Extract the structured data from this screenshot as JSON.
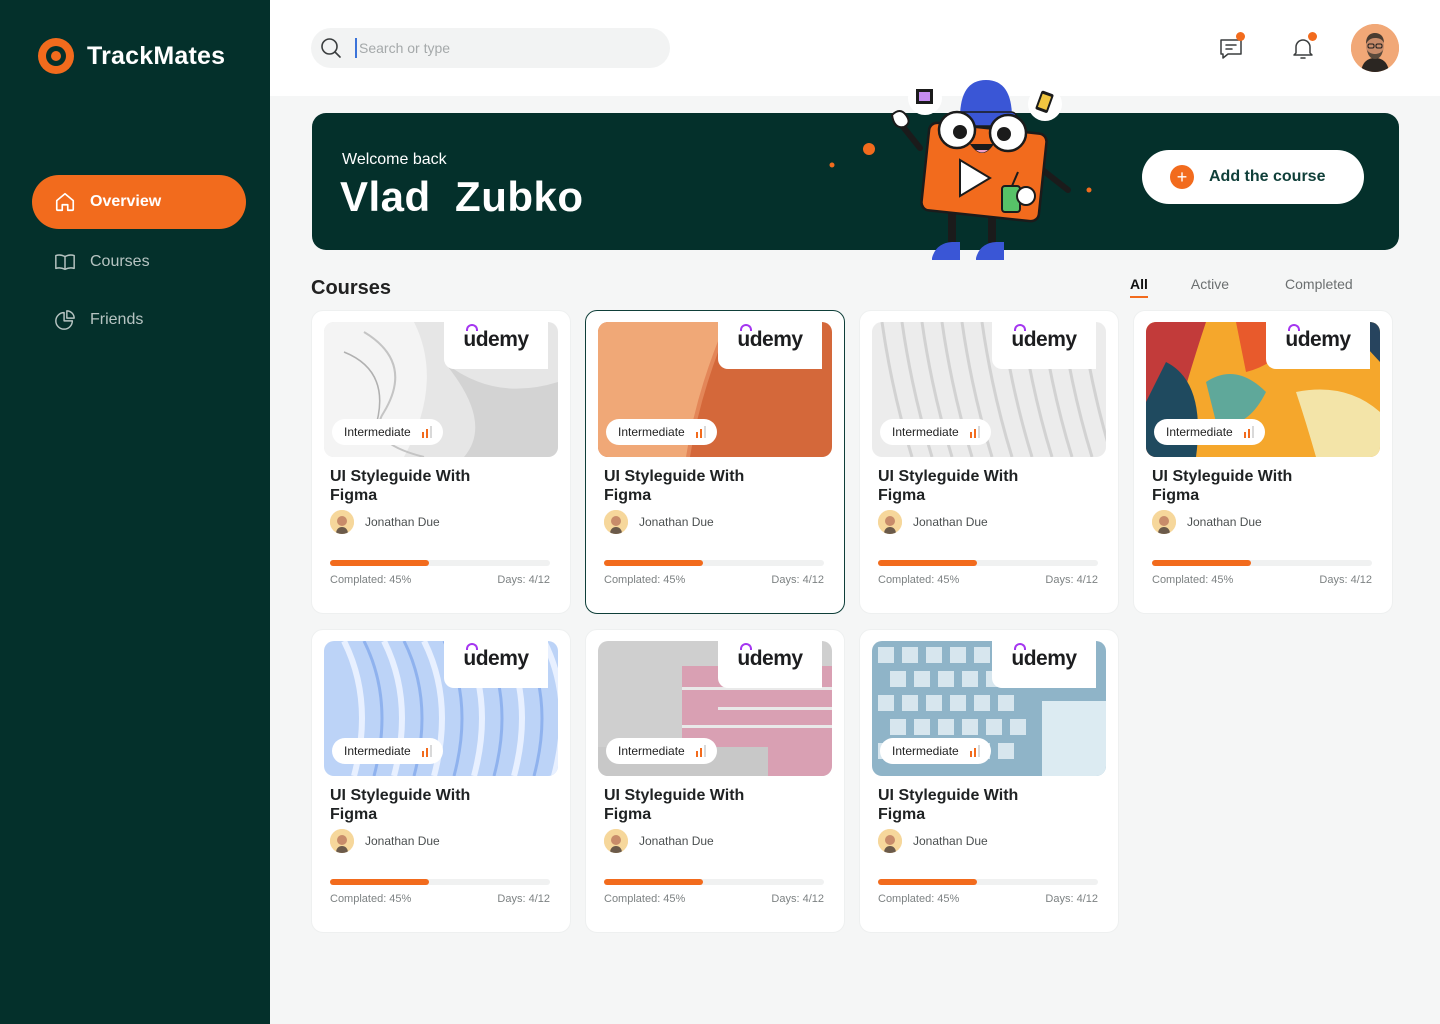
{
  "brand": {
    "name": "TrackMates",
    "accent": "#f26b1d",
    "dark": "#04302b"
  },
  "sidebar": {
    "items": [
      {
        "label": "Overview",
        "icon": "home-icon",
        "active": true
      },
      {
        "label": "Courses",
        "icon": "book-icon",
        "active": false
      },
      {
        "label": "Friends",
        "icon": "pie-chart-icon",
        "active": false
      }
    ]
  },
  "topbar": {
    "search_placeholder": "Search or type",
    "icons": [
      "message-icon",
      "bell-icon"
    ]
  },
  "banner": {
    "welcome": "Welcome back",
    "first_name": "Vlad",
    "last_name": "Zubko",
    "add_label": "Add the course"
  },
  "courses": {
    "title": "Courses",
    "filters": [
      "All",
      "Active",
      "Completed"
    ],
    "selected_filter": "All",
    "items": [
      {
        "provider": "udemy",
        "level": "Intermediate",
        "title": "UI Styleguide With Figma",
        "author": "Jonathan Due",
        "progress": 0.45,
        "completed_label": "Complated: 45%",
        "days_label": "Days: 4/12",
        "selected": false,
        "thumb": "grey-fabric"
      },
      {
        "provider": "udemy",
        "level": "Intermediate",
        "title": "UI Styleguide With Figma",
        "author": "Jonathan Due",
        "progress": 0.45,
        "completed_label": "Complated: 45%",
        "days_label": "Days: 4/12",
        "selected": true,
        "thumb": "orange-wall"
      },
      {
        "provider": "udemy",
        "level": "Intermediate",
        "title": "UI Styleguide With Figma",
        "author": "Jonathan Due",
        "progress": 0.45,
        "completed_label": "Complated: 45%",
        "days_label": "Days: 4/12",
        "selected": false,
        "thumb": "white-waves"
      },
      {
        "provider": "udemy",
        "level": "Intermediate",
        "title": "UI Styleguide With Figma",
        "author": "Jonathan Due",
        "progress": 0.45,
        "completed_label": "Complated: 45%",
        "days_label": "Days: 4/12",
        "selected": false,
        "thumb": "colorful-paint"
      },
      {
        "provider": "udemy",
        "level": "Intermediate",
        "title": "UI Styleguide With Figma",
        "author": "Jonathan Due",
        "progress": 0.45,
        "completed_label": "Complated: 45%",
        "days_label": "Days: 4/12",
        "selected": false,
        "thumb": "blue-waves"
      },
      {
        "provider": "udemy",
        "level": "Intermediate",
        "title": "UI Styleguide With Figma",
        "author": "Jonathan Due",
        "progress": 0.45,
        "completed_label": "Complated: 45%",
        "days_label": "Days: 4/12",
        "selected": false,
        "thumb": "pink-wall"
      },
      {
        "provider": "udemy",
        "level": "Intermediate",
        "title": "UI Styleguide With Figma",
        "author": "Jonathan Due",
        "progress": 0.45,
        "completed_label": "Complated: 45%",
        "days_label": "Days: 4/12",
        "selected": false,
        "thumb": "glass-building"
      }
    ]
  }
}
